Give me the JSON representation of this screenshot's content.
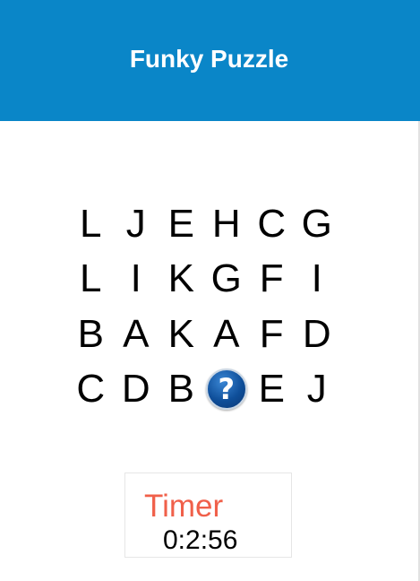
{
  "header": {
    "title": "Funky Puzzle",
    "bg_color": "#0a86c8"
  },
  "grid": {
    "rows": [
      [
        "L",
        "J",
        "E",
        "H",
        "C",
        "G"
      ],
      [
        "L",
        "I",
        "K",
        "G",
        "F",
        "I"
      ],
      [
        "B",
        "A",
        "K",
        "A",
        "F",
        "D"
      ],
      [
        "C",
        "D",
        "B",
        "?",
        "E",
        "J"
      ]
    ],
    "hidden_cell_icon": "question-mark-icon",
    "hidden_cell_glyph": "?"
  },
  "timer": {
    "label": "Timer",
    "value": "0:2:56",
    "label_color": "#f0604a"
  }
}
